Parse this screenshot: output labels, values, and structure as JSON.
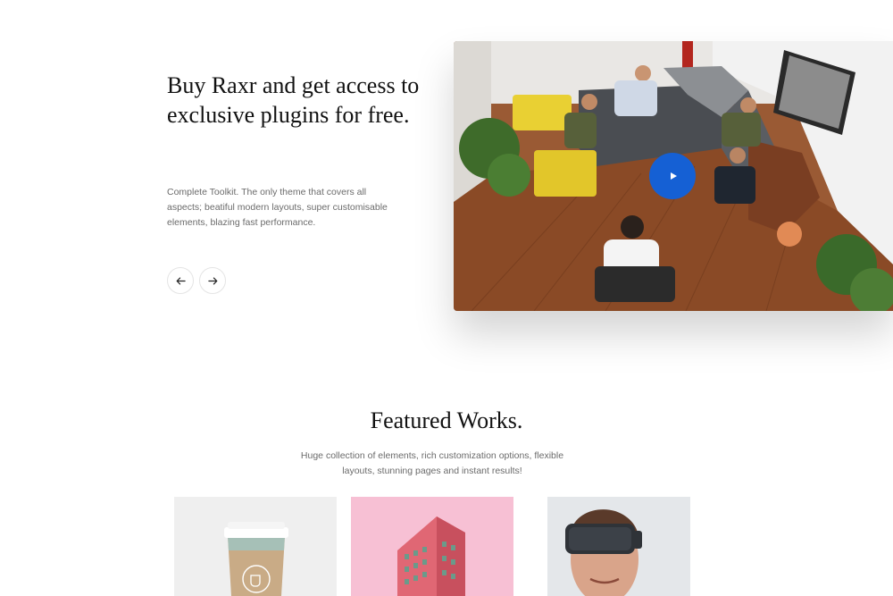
{
  "hero": {
    "title": "Buy Raxr and get access to exclusive plugins for free.",
    "description": "Complete Toolkit. The only theme that covers all aspects; beatiful modern layouts, super customisable elements, blazing fast performance.",
    "prev_icon": "arrow-left-icon",
    "next_icon": "arrow-right-icon"
  },
  "video": {
    "play_icon": "play-icon",
    "accent": "#1560d4"
  },
  "featured": {
    "title": "Featured Works.",
    "subtitle": "Huge collection of elements, rich customization options, flexible layouts, stunning pages and instant results!",
    "items": [
      {
        "image": "coffee-cup"
      },
      {
        "image": "pink-building"
      },
      {
        "image": "vr-headset-man"
      }
    ]
  }
}
